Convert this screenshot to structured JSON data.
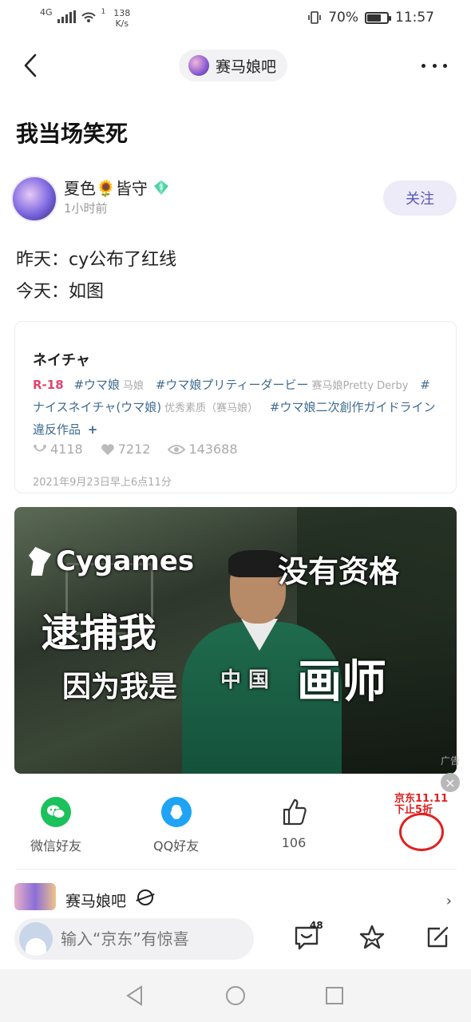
{
  "status_bar": {
    "network": "4G",
    "speed": "138",
    "speed_unit": "K/s",
    "wifi_badge": "1",
    "battery": "70%",
    "battery_level": 0.7,
    "time": "11:57"
  },
  "nav": {
    "forum_name": "赛马娘吧"
  },
  "post": {
    "title": "我当场笑死",
    "author": "夏色🌻皆守",
    "time": "1小时前",
    "follow_label": "关注",
    "lines": [
      "昨天：cy公布了红线",
      "今天：如图"
    ]
  },
  "card": {
    "title": "ネイチャ",
    "r18": "R-18",
    "tags": [
      {
        "tag": "#ウマ娘",
        "sub": "马娘"
      },
      {
        "tag": "#ウマ娘プリティーダービー",
        "sub": "赛马娘Pretty Derby"
      },
      {
        "tag": "#ナイスネイチャ(ウマ娘)",
        "sub": "优秀素质（赛马娘）"
      },
      {
        "tag": "#ウマ娘二次創作ガイドライン違反作品",
        "sub": ""
      }
    ],
    "plus": "+",
    "stats": {
      "bookmarks": "4118",
      "likes": "7212",
      "views": "143688"
    },
    "date": "2021年9月23日早上6点11分"
  },
  "meme": {
    "logo": "Cygames",
    "line1": "没有资格",
    "line2": "逮捕我",
    "line3": "因为我是",
    "line4": "画师",
    "china": "中 国"
  },
  "ad": {
    "label": "广告",
    "close": "×",
    "promo_line1": "京东11.11",
    "promo_line2": "下止5折"
  },
  "share": {
    "wechat": "微信好友",
    "qq": "QQ好友",
    "like_count": "106"
  },
  "forum_link": {
    "name": "赛马娘吧",
    "arrow": "›"
  },
  "bottom": {
    "input_placeholder": "输入“京东”有惊喜",
    "comment_count": "48"
  },
  "colors": {
    "accent": "#5a57b6",
    "wechat": "#1bc15b",
    "qq": "#1ea3f5",
    "r18": "#e0456f",
    "tag": "#3d6b8f"
  }
}
